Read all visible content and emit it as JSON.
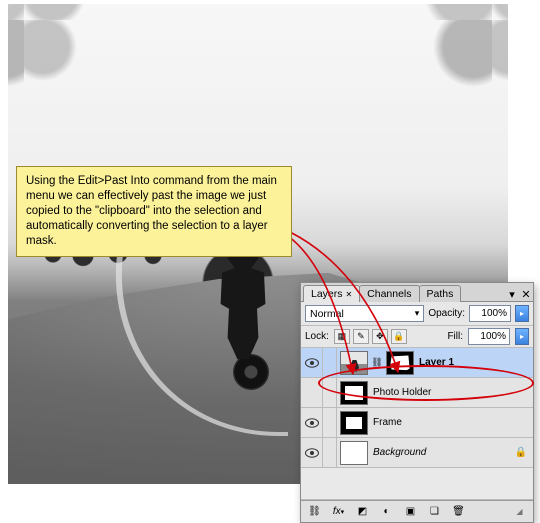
{
  "note": {
    "text": "Using the Edit>Past Into command from the main menu we can effectively past the image we just copied to the \"clipboard\" into the selection and automatically converting the selection to a layer mask."
  },
  "panel": {
    "tabs": {
      "layers": "Layers",
      "channels": "Channels",
      "paths": "Paths"
    },
    "blend_mode": "Normal",
    "opacity_label": "Opacity:",
    "opacity_value": "100%",
    "lock_label": "Lock:",
    "fill_label": "Fill:",
    "fill_value": "100%",
    "layers": [
      {
        "name": "Layer 1"
      },
      {
        "name": "Photo Holder"
      },
      {
        "name": "Frame"
      },
      {
        "name": "Background"
      }
    ]
  }
}
